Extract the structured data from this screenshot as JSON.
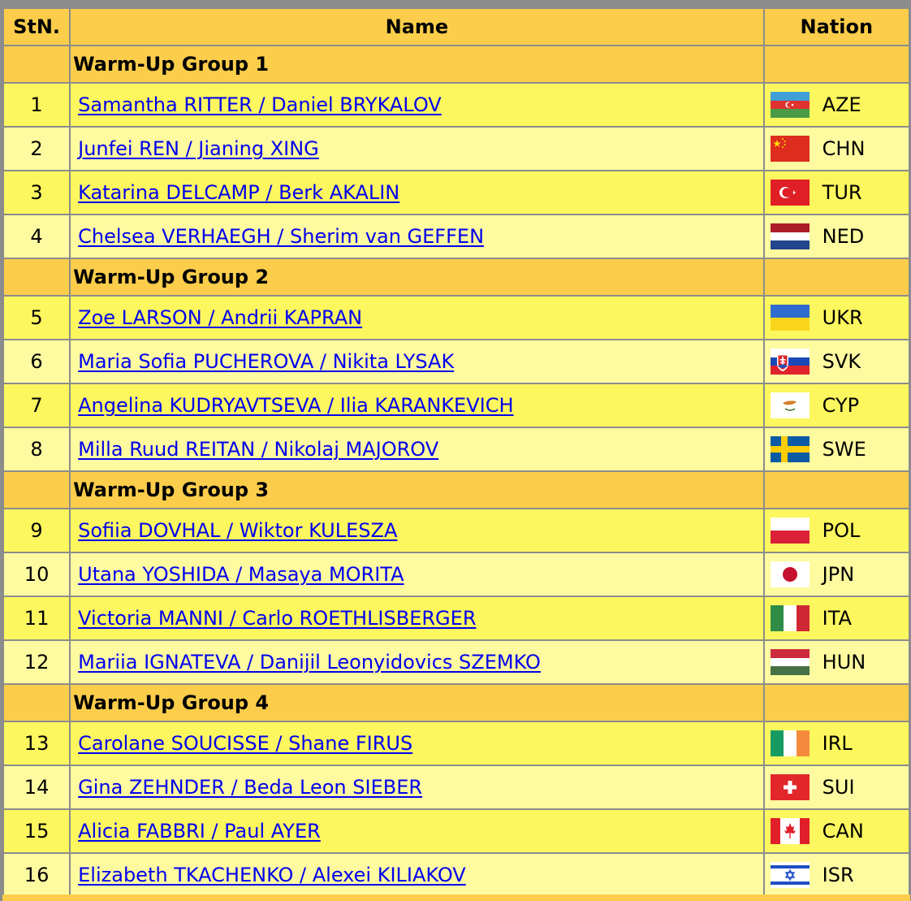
{
  "headers": {
    "stn": "StN.",
    "name": "Name",
    "nation": "Nation"
  },
  "groups": [
    {
      "label": "Warm-Up Group 1",
      "rows": [
        {
          "stn": "1",
          "name": "Samantha RITTER / Daniel BRYKALOV",
          "nation": "AZE",
          "flag_icon": "azerbaijan-flag-icon"
        },
        {
          "stn": "2",
          "name": "Junfei REN / Jianing XING",
          "nation": "CHN",
          "flag_icon": "china-flag-icon"
        },
        {
          "stn": "3",
          "name": "Katarina DELCAMP / Berk AKALIN",
          "nation": "TUR",
          "flag_icon": "turkey-flag-icon"
        },
        {
          "stn": "4",
          "name": "Chelsea VERHAEGH / Sherim van GEFFEN",
          "nation": "NED",
          "flag_icon": "netherlands-flag-icon"
        }
      ]
    },
    {
      "label": "Warm-Up Group 2",
      "rows": [
        {
          "stn": "5",
          "name": "Zoe LARSON / Andrii KAPRAN",
          "nation": "UKR",
          "flag_icon": "ukraine-flag-icon"
        },
        {
          "stn": "6",
          "name": "Maria Sofia PUCHEROVA / Nikita LYSAK",
          "nation": "SVK",
          "flag_icon": "slovakia-flag-icon"
        },
        {
          "stn": "7",
          "name": "Angelina KUDRYAVTSEVA / Ilia KARANKEVICH",
          "nation": "CYP",
          "flag_icon": "cyprus-flag-icon"
        },
        {
          "stn": "8",
          "name": "Milla Ruud REITAN / Nikolaj MAJOROV",
          "nation": "SWE",
          "flag_icon": "sweden-flag-icon"
        }
      ]
    },
    {
      "label": "Warm-Up Group 3",
      "rows": [
        {
          "stn": "9",
          "name": "Sofiia DOVHAL / Wiktor KULESZA",
          "nation": "POL",
          "flag_icon": "poland-flag-icon"
        },
        {
          "stn": "10",
          "name": "Utana YOSHIDA / Masaya MORITA",
          "nation": "JPN",
          "flag_icon": "japan-flag-icon"
        },
        {
          "stn": "11",
          "name": "Victoria MANNI / Carlo ROETHLISBERGER",
          "nation": "ITA",
          "flag_icon": "italy-flag-icon"
        },
        {
          "stn": "12",
          "name": "Mariia IGNATEVA / Danijil Leonyidovics SZEMKO",
          "nation": "HUN",
          "flag_icon": "hungary-flag-icon"
        }
      ]
    },
    {
      "label": "Warm-Up Group 4",
      "rows": [
        {
          "stn": "13",
          "name": "Carolane SOUCISSE / Shane FIRUS",
          "nation": "IRL",
          "flag_icon": "ireland-flag-icon"
        },
        {
          "stn": "14",
          "name": "Gina ZEHNDER / Beda Leon SIEBER",
          "nation": "SUI",
          "flag_icon": "switzerland-flag-icon"
        },
        {
          "stn": "15",
          "name": "Alicia FABBRI / Paul AYER",
          "nation": "CAN",
          "flag_icon": "canada-flag-icon"
        },
        {
          "stn": "16",
          "name": "Elizabeth TKACHENKO / Alexei KILIAKOV",
          "nation": "ISR",
          "flag_icon": "israel-flag-icon"
        }
      ]
    }
  ],
  "colors": {
    "header_bg": "#fbcd4b",
    "row_odd_bg": "#fcf75e",
    "row_even_bg": "#fdfaa0",
    "link": "#0000ee",
    "border": "#8c8c8c"
  }
}
